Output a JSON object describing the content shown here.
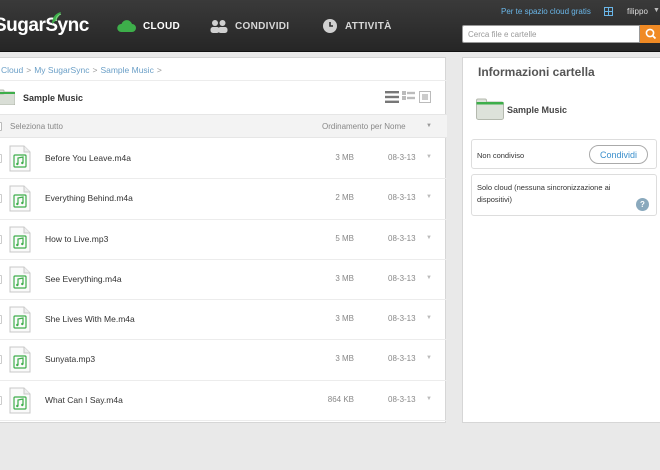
{
  "header": {
    "logo": "SugarSync",
    "nav": [
      {
        "label": "CLOUD",
        "icon": "cloud-icon",
        "active": true
      },
      {
        "label": "CONDIVIDI",
        "icon": "people-icon",
        "active": false
      },
      {
        "label": "ATTIVITÀ",
        "icon": "clock-icon",
        "active": false
      }
    ],
    "promo": "Per te spazio cloud gratis",
    "user": "filippo",
    "search_placeholder": "Cerca file e cartelle"
  },
  "breadcrumb": [
    "Cloud",
    "My SugarSync",
    "Sample Music"
  ],
  "folder": {
    "name": "Sample Music"
  },
  "list_header": {
    "select_all": "Seleziona tutto",
    "sort": "Ordinamento per Nome"
  },
  "files": [
    {
      "name": "Before You Leave.m4a",
      "size": "3 MB",
      "date": "08-3-13"
    },
    {
      "name": "Everything Behind.m4a",
      "size": "2 MB",
      "date": "08-3-13"
    },
    {
      "name": "How to Live.mp3",
      "size": "5 MB",
      "date": "08-3-13"
    },
    {
      "name": "See Everything.m4a",
      "size": "3 MB",
      "date": "08-3-13"
    },
    {
      "name": "She Lives With Me.m4a",
      "size": "3 MB",
      "date": "08-3-13"
    },
    {
      "name": "Sunyata.mp3",
      "size": "3 MB",
      "date": "08-3-13"
    },
    {
      "name": "What Can I Say.m4a",
      "size": "864 KB",
      "date": "08-3-13"
    }
  ],
  "side": {
    "title": "Informazioni cartella",
    "folder_name": "Sample Music",
    "share_status": "Non condiviso",
    "share_button": "Condividi",
    "sync_text": "Solo cloud (nessuna sincronizzazione ai dispositivi)",
    "help": "?"
  },
  "colors": {
    "accent": "#6a9fc7",
    "brand_green": "#3dae4a",
    "search_button": "#f08a24"
  }
}
